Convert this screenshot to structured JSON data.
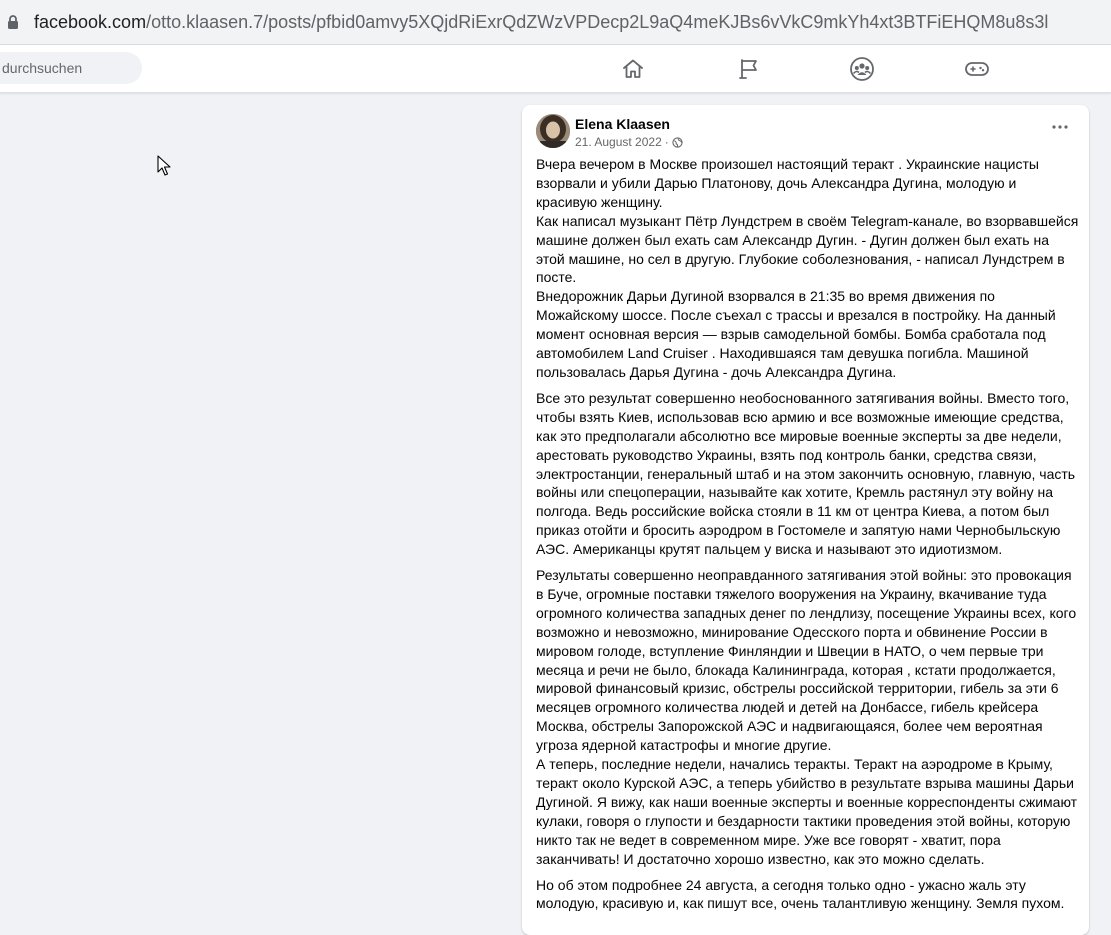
{
  "browser": {
    "url_host": "facebook.com",
    "url_path": "/otto.klaasen.7/posts/pfbid0amvy5XQjdRiExrQdZWzVPDecp2L9aQ4meKJBs6vVkC9mkYh4xt3BTFiEHQM8u8s3l"
  },
  "nav": {
    "search_placeholder": "durchsuchen",
    "icons": [
      "home-icon",
      "flag-icon",
      "groups-icon",
      "gaming-icon"
    ]
  },
  "post": {
    "author": "Elena Klaasen",
    "date": "21. August 2022",
    "separator": "·",
    "privacy_icon": "globe-icon",
    "paragraphs": [
      "Вчера вечером в Москве произошел настоящий теракт . Украинские нацисты взорвали и убили Дарью Платонову, дочь Александра Дугина, молодую и красивую женщину.\nКак написал музыкант Пётр Лундстрем в своём Telegram-канале, во взорвавшейся машине должен был ехать сам Александр Дугин. - Дугин должен был ехать на этой машине, но сел в другую. Глубокие соболезнования, - написал Лундстрем в посте.\nВнедорожник Дарьи Дугиной взорвался в 21:35 во время движения по Можайскому шоссе. После съехал с трассы и врезался в постройку. На данный момент основная версия — взрыв самодельной бомбы. Бомба сработала под автомобилем Land Cruiser . Находившаяся там девушка погибла. Машиной пользовалась Дарья Дугина - дочь Александра Дугина.",
      "Все это результат совершенно необоснованного затягивания войны. Вместо того, чтобы взять Киев, использовав всю армию и все возможные имеющие средства, как это предполагали абсолютно все мировые военные эксперты  за две недели, арестовать руководство Украины, взять под контроль банки, средства связи, электростанции, генеральный штаб и на этом закончить основную, главную, часть войны или спецоперации, называйте как хотите, Кремль растянул эту войну на полгода. Ведь российские войска стояли в 11 км от центра Киева, а потом был приказ отойти и бросить аэродром в Гостомеле и  запятую нами Чернобыльскую АЭС. Американцы крутят пальцем у виска и называют это идиотизмом.",
      " Результаты совершенно неоправданного затягивания этой  войны:  это провокация в Буче, огромные поставки тяжелого вооружения на Украину, вкачивание туда огромного количества западных денег по лендлизу, посещение Украины всех, кого возможно и невозможно,  минирование Одесского  порта и обвинение России в мировом голоде, вступление Финляндии и Швеции в НАТО, о чем первые три месяца и речи не было, блокада Калининграда, которая , кстати продолжается, мировой финансовый кризис, обстрелы российской территории, гибель за эти 6 месяцев огромного количества людей и детей на Донбассе, гибель крейсера Москва, обстрелы Запорожской АЭС и надвигающаяся, более чем вероятная угроза  ядерной катастрофы и многие другие.\nА теперь, последние недели, начались теракты. Теракт на аэродроме в Крыму, теракт около Курской АЭС,  а теперь убийство в результате взрыва машины Дарьи Дугиной.  Я вижу, как наши военные эксперты и военные корреспонденты сжимают кулаки, говоря о глупости и бездарности тактики проведения этой войны,  которую никто так не ведет в современном мире. Уже все говорят  - хватит, пора заканчивать!  И достаточно хорошо известно, как это можно сделать.",
      "Но об этом подробнее 24 августа, а сегодня только одно  - ужасно жаль эту молодую, красивую и, как пишут все, очень талантливую женщину. Земля пухом."
    ]
  }
}
